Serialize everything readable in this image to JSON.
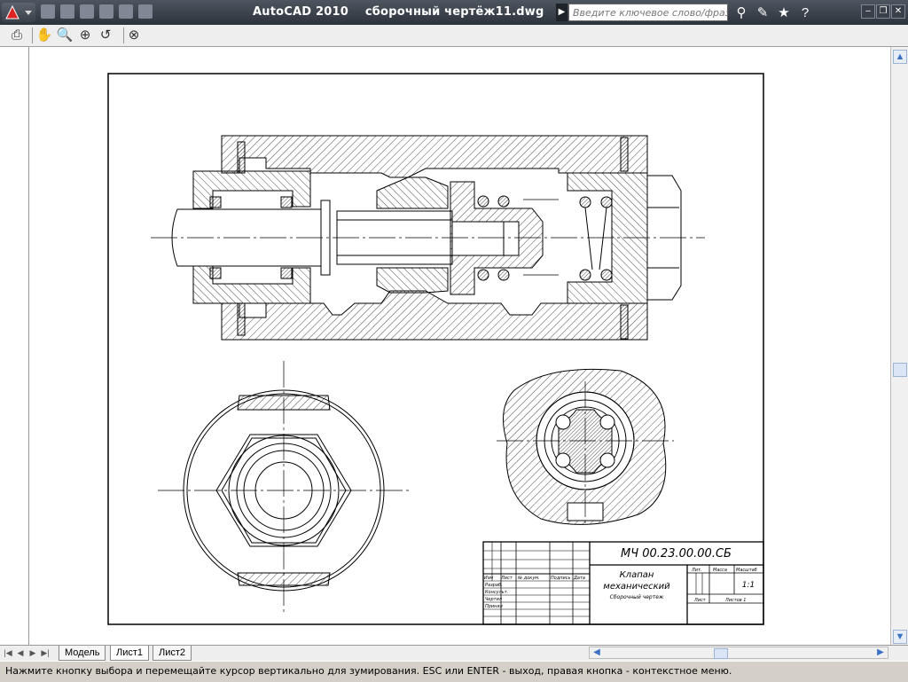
{
  "window": {
    "app_title": "AutoCAD 2010",
    "file_title": "сборочный чертёж11.dwg",
    "search_placeholder": "Введите ключевое слово/фразу"
  },
  "toolbar": {
    "icons": [
      "print-icon",
      "pan-icon",
      "zoom-realtime-icon",
      "zoom-window-icon",
      "zoom-previous-icon",
      "close-preview-icon"
    ]
  },
  "drawing": {
    "title_block": {
      "designation": "МЧ 00.23.00.00.СБ",
      "name_line1": "Клапан",
      "name_line2": "механический",
      "doc_type": "Сборочный чертеж",
      "col_izm": "Изм",
      "col_list": "Лист",
      "col_doc": "№ докум.",
      "col_sign": "Подпись",
      "col_date": "Дата",
      "row_razrab": "Разраб.",
      "row_konsult": "Консульт.",
      "row_chertil": "Чертил",
      "row_prinyal": "Принял",
      "lit": "Лит.",
      "massa": "Масса",
      "masshtab": "Масштаб",
      "scale_value": "1:1",
      "list_label": "Лист",
      "listov_label": "Листов 1"
    }
  },
  "tabs": [
    {
      "label": "Модель",
      "active": false
    },
    {
      "label": "Лист1",
      "active": true
    },
    {
      "label": "Лист2",
      "active": false
    }
  ],
  "status": {
    "prompt": "Нажмите кнопку выбора и перемещайте курсор вертикально для зумирования. ESC или ENTER - выход, правая кнопка - контекстное меню."
  },
  "colors": {
    "titlebar": "#2d333b",
    "accent": "#3b70c4",
    "paper": "#ffffff",
    "line": "#000000"
  }
}
